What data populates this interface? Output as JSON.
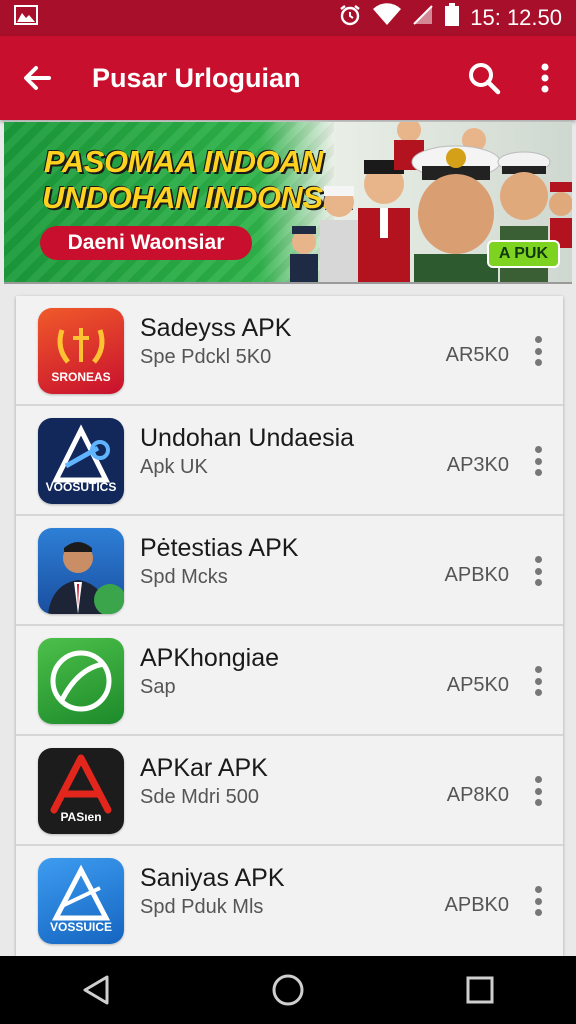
{
  "status_bar": {
    "time": "15: 12.50"
  },
  "app_bar": {
    "title": "Pusar Urloguian"
  },
  "banner": {
    "headline_1": "PASOMAA INDOAN",
    "headline_2": "UNDOHAN INDONSIA",
    "button_label": "Daeni Waonsiar",
    "badge": "A PUK"
  },
  "apps": [
    {
      "name": "Sadeyss APK",
      "subtitle": "Spe Pdckl 5K0",
      "size": "AR5K0",
      "icon_label": "SRONEAS",
      "icon": "laurel-icon"
    },
    {
      "name": "Undohan Undaesia",
      "subtitle": "Apk UK",
      "size": "AP3K0",
      "icon_label": "VOOSUTICS",
      "icon": "triangle-logo-icon"
    },
    {
      "name": "Pėtestias APK",
      "subtitle": "Spd Mcks",
      "size": "APBK0",
      "icon_label": "",
      "icon": "person-photo-icon"
    },
    {
      "name": "APKhongiae",
      "subtitle": "Sap",
      "size": "AP5K0",
      "icon_label": "",
      "icon": "leaf-logo-icon"
    },
    {
      "name": "APKar APK",
      "subtitle": "Sde Mdri 500",
      "size": "AP8K0",
      "icon_label": "PASıen",
      "icon": "red-a-logo-icon"
    },
    {
      "name": "Saniyas APK",
      "subtitle": "Spd Pduk Mls",
      "size": "APBK0",
      "icon_label": "VOSSUICE",
      "icon": "blue-a-logo-icon"
    }
  ],
  "colors": {
    "primary": "#c8102e",
    "status": "#a80f2a",
    "banner_green": "#2fb34a",
    "banner_yellow": "#ffd21f"
  }
}
